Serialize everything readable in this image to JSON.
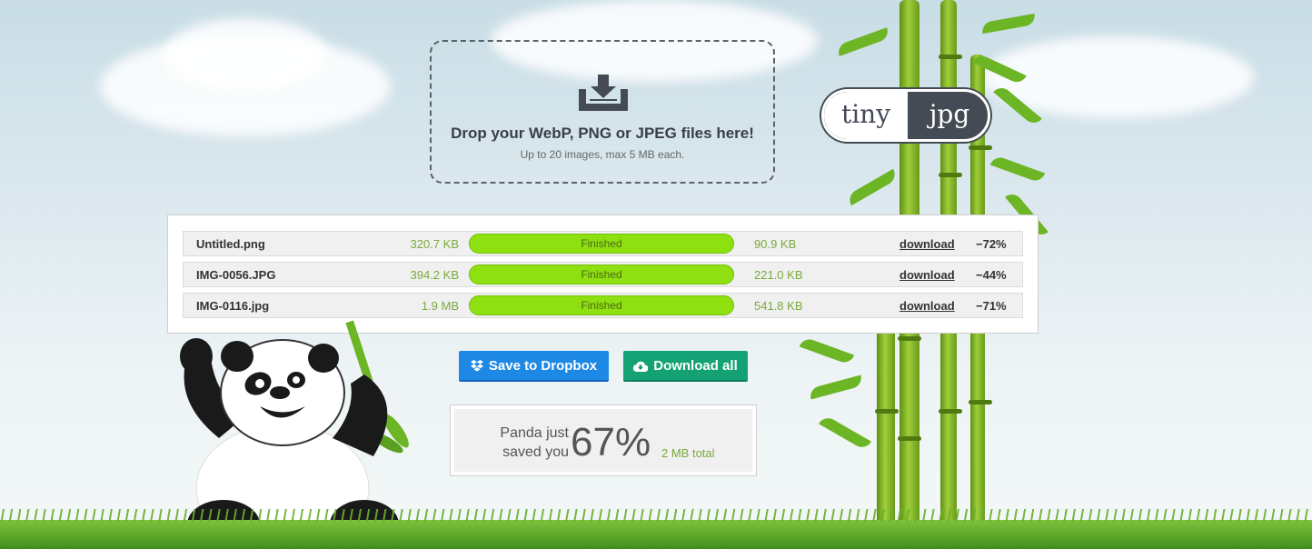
{
  "dropzone": {
    "title": "Drop your WebP, PNG or JPEG files here!",
    "subtitle": "Up to 20 images, max 5 MB each.",
    "icon": "download-tray-icon"
  },
  "logo": {
    "left": "tiny",
    "right": "jpg"
  },
  "files": [
    {
      "name": "Untitled.png",
      "original_size": "320.7 KB",
      "status": "Finished",
      "new_size": "90.9 KB",
      "download": "download",
      "saving": "−72%"
    },
    {
      "name": "IMG-0056.JPG",
      "original_size": "394.2 KB",
      "status": "Finished",
      "new_size": "221.0 KB",
      "download": "download",
      "saving": "−44%"
    },
    {
      "name": "IMG-0116.jpg",
      "original_size": "1.9 MB",
      "status": "Finished",
      "new_size": "541.8 KB",
      "download": "download",
      "saving": "−71%"
    }
  ],
  "buttons": {
    "dropbox": "Save to Dropbox",
    "download_all": "Download all"
  },
  "savings": {
    "label_line1": "Panda just",
    "label_line2": "saved you",
    "percent": "67%",
    "total": "2 MB total"
  },
  "colors": {
    "progress_green": "#8ee010",
    "dropbox_blue": "#1e88e5",
    "download_green": "#14a274",
    "logo_dark": "#444b54"
  }
}
